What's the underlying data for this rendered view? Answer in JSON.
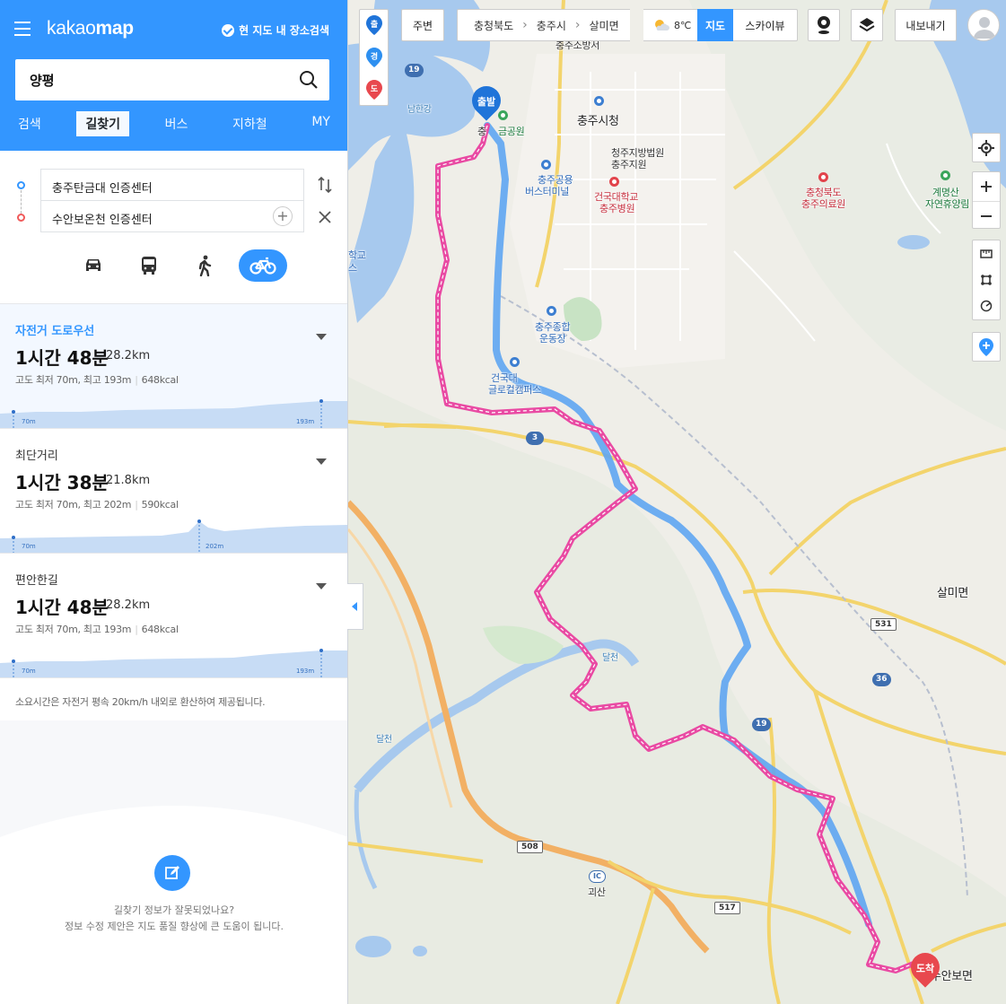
{
  "header": {
    "logo_main": "kakao",
    "logo_bold": "map",
    "area_search_label": "현 지도 내 장소검색"
  },
  "search": {
    "value": "양평"
  },
  "tabs": [
    {
      "label": "검색"
    },
    {
      "label": "길찾기",
      "active": true
    },
    {
      "label": "버스"
    },
    {
      "label": "지하철"
    },
    {
      "label": "MY"
    }
  ],
  "route": {
    "origin": "충주탄금대 인증센터",
    "destination": "수안보온천 인증센터",
    "modes": [
      "car-icon",
      "bus-icon",
      "walk-icon",
      "bicycle-icon"
    ],
    "active_mode": "bicycle"
  },
  "results": [
    {
      "type": "자전거 도로우선",
      "time": "1시간 48분",
      "distance": "28.2km",
      "elevation_prefix": "고도 최저 70m, 최고 193m",
      "kcal": "648kcal",
      "profile_min": "70m",
      "profile_max": "193m",
      "selected": true
    },
    {
      "type": "최단거리",
      "time": "1시간 38분",
      "distance": "21.8km",
      "elevation_prefix": "고도 최저 70m, 최고 202m",
      "kcal": "590kcal",
      "profile_min": "70m",
      "profile_max": "202m",
      "selected": false
    },
    {
      "type": "편안한길",
      "time": "1시간 48분",
      "distance": "28.2km",
      "elevation_prefix": "고도 최저 70m, 최고 193m",
      "kcal": "648kcal",
      "profile_min": "70m",
      "profile_max": "193m",
      "selected": false
    }
  ],
  "notice": "소요시간은 자전거 평속 20km/h 내외로 환산하여 제공됩니다.",
  "feedback": {
    "question": "길찾기 정보가 잘못되었나요?",
    "description": "정보 수정 제안은 지도 품질 향상에 큰 도움이 됩니다."
  },
  "map": {
    "marker_stack": [
      "출",
      "경",
      "도"
    ],
    "around_label": "주변",
    "breadcrumb": [
      "충청북도",
      "충주시",
      "살미면"
    ],
    "weather_temp": "8℃",
    "map_type": "지도",
    "skyview": "스카이뷰",
    "export_label": "내보내기",
    "start_pin": "출발",
    "end_pin": "도착",
    "labels": {
      "fire_station": "충주소방서",
      "city_hall": "충주시청",
      "court": "청주지방법원",
      "court2": "충주지원",
      "park": "금공원",
      "terminal": "충주공용",
      "terminal2": "버스터미널",
      "hospital": "건국대학교",
      "hospital2": "충주병원",
      "stadium": "충주종합",
      "stadium2": "운동장",
      "campus": "건국대",
      "campus2": "글로컬캠퍼스",
      "medical": "충청북도",
      "medical2": "충주의료원",
      "forest": "계명산",
      "forest2": "자연휴양림",
      "salmi": "살미면",
      "suanbo": "수안보면",
      "namhan": "남한강",
      "dalcheon": "달천",
      "dalcheon2": "달천",
      "school": "학교",
      "school2": "스",
      "goesan": "괴산",
      "start_partial": "충"
    },
    "shields": [
      "19",
      "3",
      "531",
      "36",
      "19",
      "508",
      "517",
      "IC"
    ]
  }
}
